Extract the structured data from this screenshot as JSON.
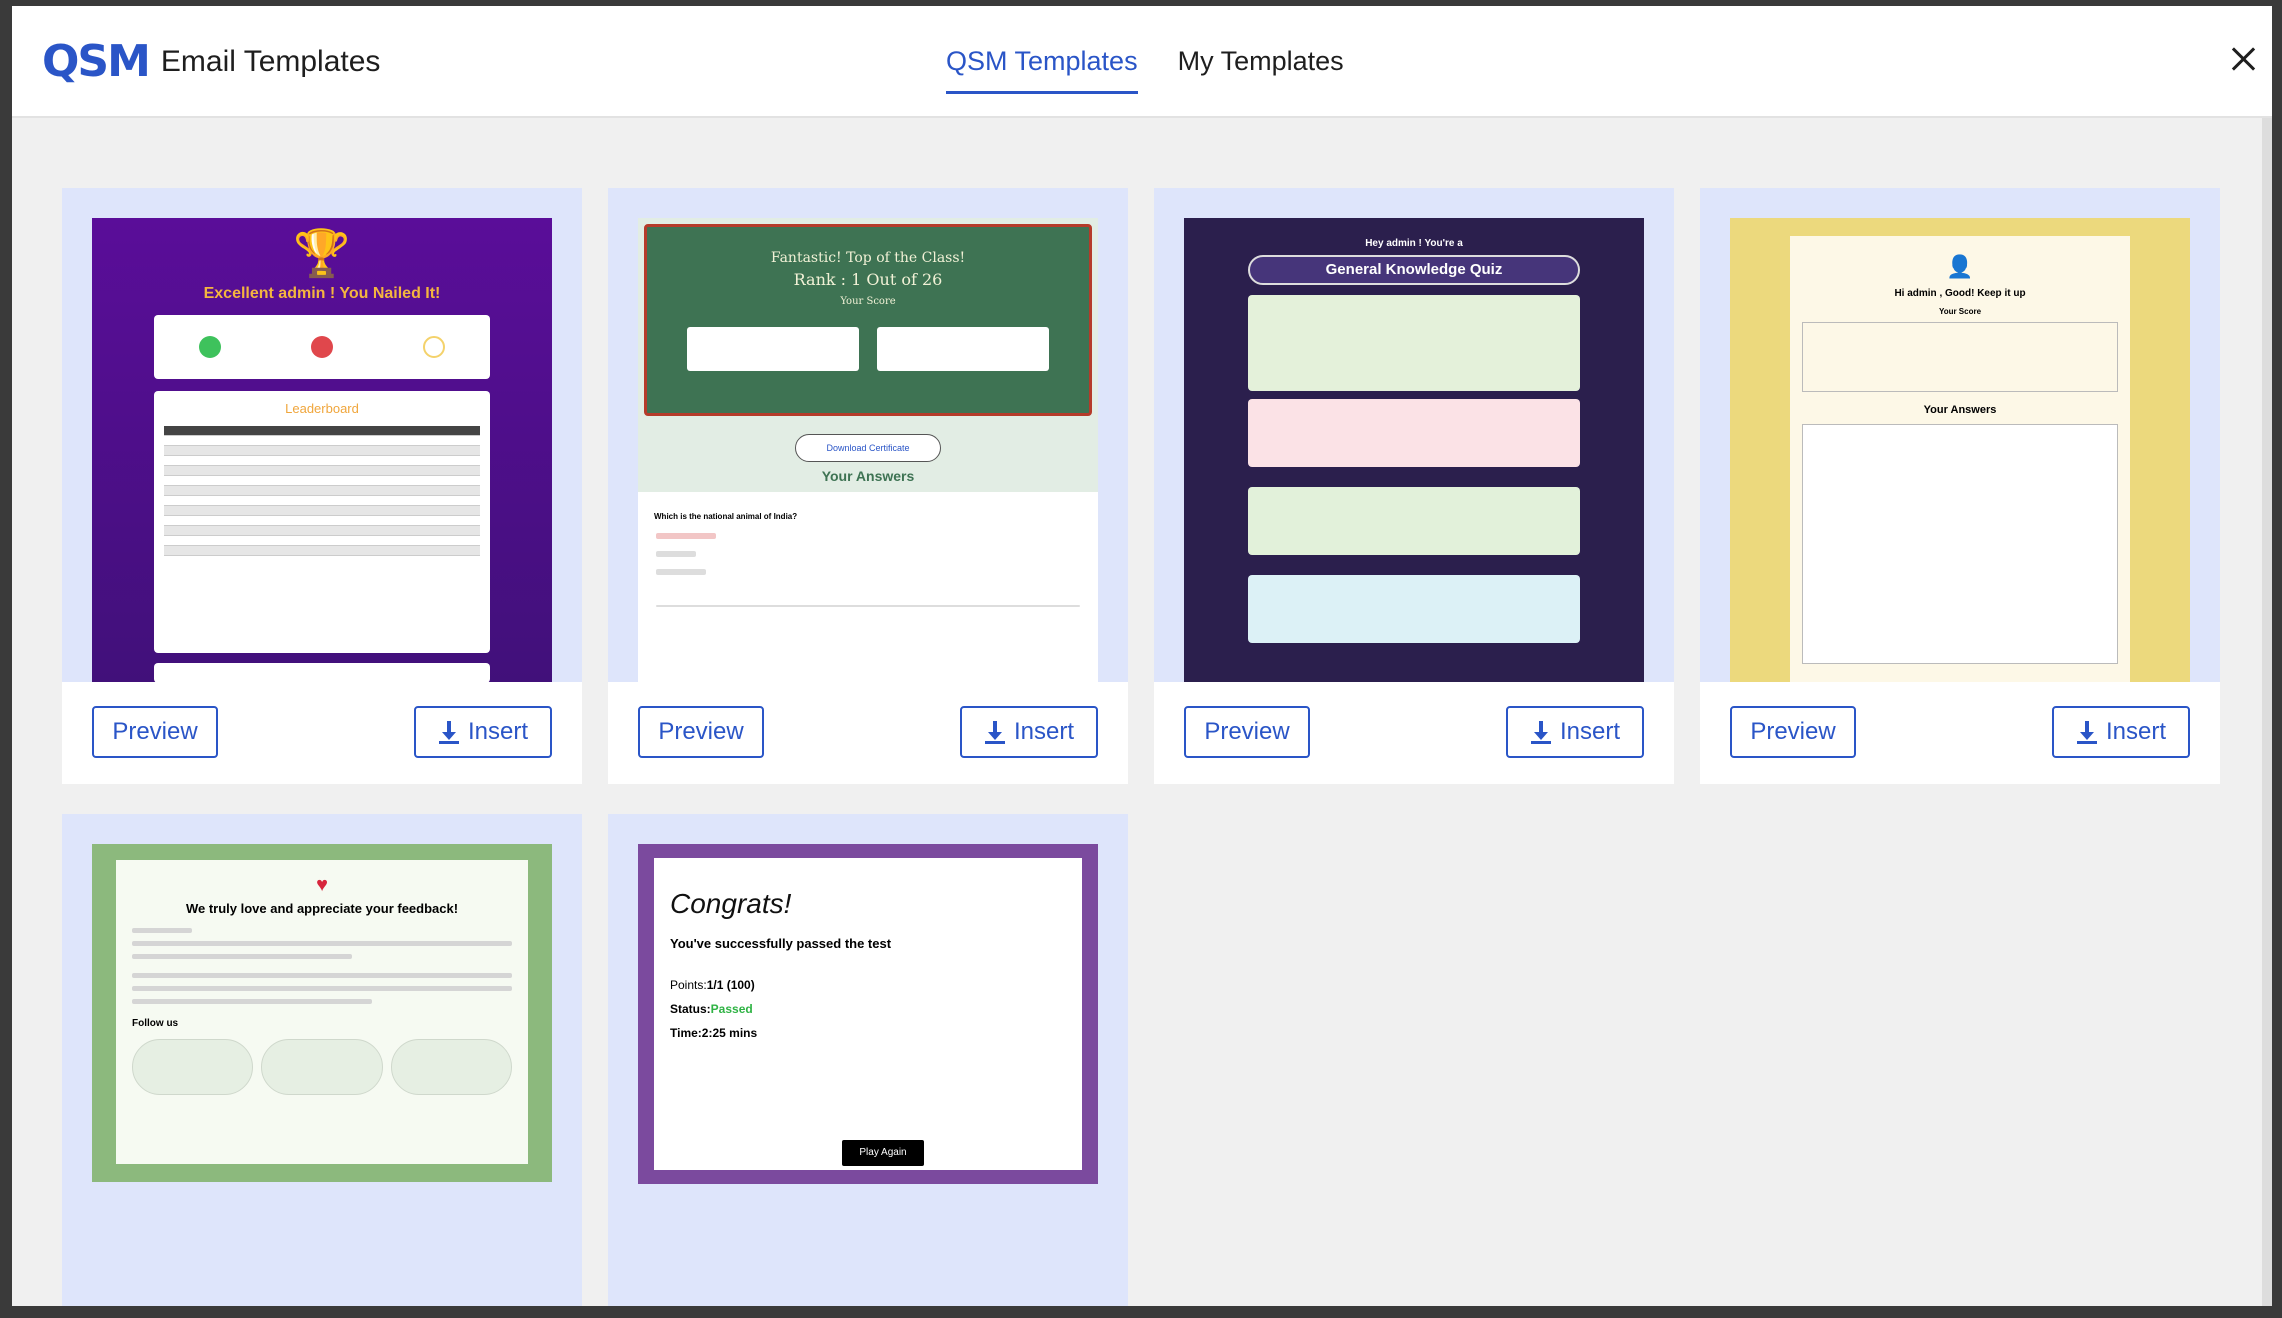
{
  "header": {
    "logo": "QSM",
    "title": "Email Templates",
    "tabs": [
      {
        "label": "QSM Templates",
        "active": true
      },
      {
        "label": "My Templates",
        "active": false
      }
    ],
    "close_icon": "close-icon"
  },
  "cards": [
    {
      "preview_label": "Preview",
      "insert_label": "Insert"
    },
    {
      "preview_label": "Preview",
      "insert_label": "Insert"
    },
    {
      "preview_label": "Preview",
      "insert_label": "Insert"
    },
    {
      "preview_label": "Preview",
      "insert_label": "Insert"
    }
  ],
  "thumbnails": {
    "t1": {
      "heading": "Excellent admin ! You Nailed It!",
      "leaderboard": "Leaderboard"
    },
    "t2": {
      "line1": "Fantastic! Top of the Class!",
      "line2": "Rank : 1 Out of 26",
      "score": "Your Score",
      "cert": "Download Certificate",
      "answers": "Your Answers",
      "question": "Which is the national animal of India?"
    },
    "t3": {
      "greet": "Hey admin ! You're a",
      "pill": "General Knowledge Quiz"
    },
    "t4": {
      "greet": "Hi admin , Good! Keep it up",
      "score": "Your Score",
      "answers": "Your Answers"
    },
    "t5": {
      "heading": "We truly love and appreciate your feedback!",
      "follow": "Follow us"
    },
    "t6": {
      "congrats": "Congrats!",
      "passed": "You've successfully passed the test",
      "points_label": "Points:",
      "points": "1/1 (100)",
      "status_label": "Status:",
      "status": "Passed",
      "time_label": "Time:",
      "time": "2:25 mins",
      "play": "Play Again"
    }
  },
  "colors": {
    "accent": "#2a55c7",
    "card_bg": "#dee5fb",
    "passed": "#2fb344"
  }
}
